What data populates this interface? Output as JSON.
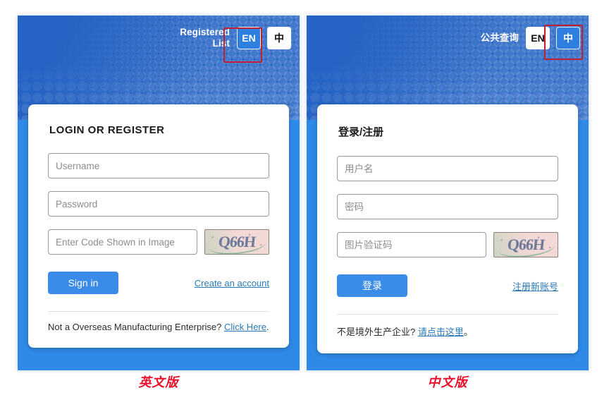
{
  "panels": [
    {
      "id": "english",
      "header": {
        "title": "Registered List",
        "lang_buttons": [
          {
            "label": "EN",
            "state": "active"
          },
          {
            "label": "中",
            "state": "idle"
          }
        ],
        "highlighted_button": "EN"
      },
      "card": {
        "title": "LOGIN OR REGISTER",
        "username_placeholder": "Username",
        "username_value": "",
        "password_placeholder": "Password",
        "password_value": "",
        "captcha_placeholder": "Enter Code Shown in Image",
        "captcha_value": "",
        "captcha_code": "Q66H",
        "submit_label": "Sign in",
        "register_link": "Create an account",
        "footer_text": "Not a Overseas Manufacturing Enterprise?",
        "footer_link": "Click Here",
        "footer_suffix": "."
      },
      "caption": "英文版"
    },
    {
      "id": "chinese",
      "header": {
        "title": "公共查询",
        "lang_buttons": [
          {
            "label": "EN",
            "state": "idle"
          },
          {
            "label": "中",
            "state": "active"
          }
        ],
        "highlighted_button": "中"
      },
      "card": {
        "title": "登录/注册",
        "username_placeholder": "用户名",
        "username_value": "",
        "password_placeholder": "密码",
        "password_value": "",
        "captcha_placeholder": "图片验证码",
        "captcha_value": "",
        "captcha_code": "Q66H",
        "submit_label": "登录",
        "register_link": "注册新账号",
        "footer_text": "不是境外生产企业?",
        "footer_link": "请点击这里",
        "footer_suffix": "。"
      },
      "caption": "中文版"
    }
  ],
  "colors": {
    "brand_blue": "#2563c4",
    "panel_blue": "#2f6fd0",
    "accent_blue": "#2e8ae6",
    "button_blue": "#3a8ce8",
    "link_blue": "#2a7ab9",
    "annotation_red": "#c0202f",
    "caption_red": "#e8102a"
  }
}
